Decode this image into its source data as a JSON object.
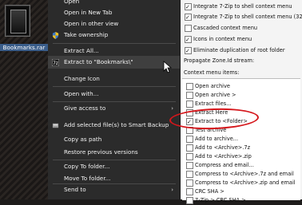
{
  "file": {
    "label": "Bookmarks.rar",
    "icon": "archive-icon"
  },
  "menu": {
    "items": [
      {
        "label": "Open"
      },
      {
        "label": "Open in New Tab"
      },
      {
        "label": "Open in other view"
      },
      {
        "label": "Take ownership",
        "icon": "shield-icon"
      },
      {
        "label": "Extract All..."
      },
      {
        "label": "Extract to \"Bookmarks\\\"",
        "icon": "7zip-icon"
      },
      {
        "label": "Change Icon"
      },
      {
        "label": "Open with..."
      },
      {
        "label": "Give access to",
        "submenu": true
      },
      {
        "label": "Add selected file(s) to Smart Backup",
        "icon": "backup-icon"
      },
      {
        "label": "Copy as path"
      },
      {
        "label": "Restore previous versions"
      },
      {
        "label": "Copy To folder..."
      },
      {
        "label": "Move To folder..."
      },
      {
        "label": "Send to",
        "submenu": true
      }
    ]
  },
  "settings": {
    "options": [
      {
        "label": "Integrate 7-Zip to shell context menu",
        "checked": true
      },
      {
        "label": "Integrate 7-Zip to shell context menu (32-bit)",
        "checked": true
      },
      {
        "label": "Cascaded context menu",
        "checked": false
      },
      {
        "label": "Icons in context menu",
        "checked": true
      },
      {
        "label": "Eliminate duplication of root folder",
        "checked": true
      }
    ],
    "propagate_label": "Propagate Zone.Id stream:",
    "context_label": "Context menu items:",
    "items": [
      {
        "label": "Open archive",
        "checked": false
      },
      {
        "label": "Open archive >",
        "checked": false
      },
      {
        "label": "Extract files...",
        "checked": false
      },
      {
        "label": "Extract Here",
        "checked": false
      },
      {
        "label": "Extract to <Folder>",
        "checked": true
      },
      {
        "label": "Test archive",
        "checked": false
      },
      {
        "label": "Add to archive...",
        "checked": false
      },
      {
        "label": "Add to <Archive>.7z",
        "checked": false
      },
      {
        "label": "Add to <Archive>.zip",
        "checked": false
      },
      {
        "label": "Compress and email...",
        "checked": false
      },
      {
        "label": "Compress to <Archive>.7z and email",
        "checked": false
      },
      {
        "label": "Compress to <Archive>.zip and email",
        "checked": false
      },
      {
        "label": "CRC SHA >",
        "checked": false
      },
      {
        "label": "7-Zip > CRC SHA >",
        "checked": false
      }
    ]
  },
  "colors": {
    "highlight_ring": "#d5161b",
    "menu_bg": "#2b2b2b",
    "panel_bg": "#f4f4f4"
  }
}
